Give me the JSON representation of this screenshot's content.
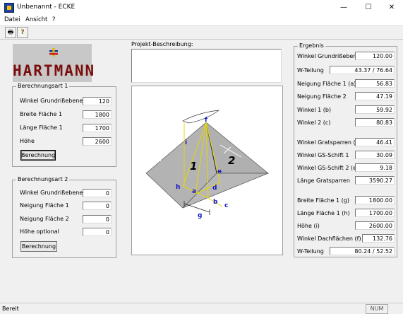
{
  "window": {
    "title": "Unbenannt - ECKE",
    "minimize": "—",
    "maximize": "☐",
    "close": "✕"
  },
  "menu": {
    "items": [
      "Datei",
      "Ansicht",
      "?"
    ]
  },
  "toolbar": {
    "print_icon": "🖶",
    "help_icon": "?"
  },
  "logo": {
    "text": "HARTMANN"
  },
  "calc1": {
    "title": "Berechnungsart 1",
    "rows": [
      {
        "label": "Winkel Grundrißebene",
        "value": "120"
      },
      {
        "label": "Breite Fläche 1",
        "value": "1800"
      },
      {
        "label": "Länge Fläche 1",
        "value": "1700"
      },
      {
        "label": "Höhe",
        "value": "2600"
      }
    ],
    "button": "Berechnung"
  },
  "calc2": {
    "title": "Berechnungsart 2",
    "rows": [
      {
        "label": "Winkel Grundrißebene",
        "value": "0"
      },
      {
        "label": "Neigung Fläche 1",
        "value": "0"
      },
      {
        "label": "Neigung Fläche 2",
        "value": "0"
      },
      {
        "label": "Höhe optional",
        "value": "0"
      }
    ],
    "button": "Berechnung"
  },
  "project": {
    "label": "Projekt-Beschreibung:",
    "value": ""
  },
  "diagram": {
    "labels": [
      "f",
      "i",
      "1",
      "2",
      "e",
      "h",
      "d",
      "a",
      "b",
      "c",
      "g"
    ]
  },
  "result": {
    "title": "Ergebnis",
    "rows": [
      {
        "label": "Winkel Grundrißebene",
        "value": "120.00"
      },
      {
        "label": "W-Teilung",
        "value": "43.37 / 76.64"
      },
      {
        "label": "Neigung Fläche 1 (a)",
        "value": "56.83"
      },
      {
        "label": "Neigung Fläche 2",
        "value": "47.19"
      },
      {
        "label": "Winkel 1 (b)",
        "value": "59.92"
      },
      {
        "label": "Winkel 2 (c)",
        "value": "80.83"
      },
      {
        "label": "Winkel Gratsparren (d)",
        "value": "46.41"
      },
      {
        "label": "Winkel GS-Schift 1",
        "value": "30.09"
      },
      {
        "label": "Winkel GS-Schift 2 (e)",
        "value": "9.18"
      },
      {
        "label": "Länge Gratsparren",
        "value": "3590.27"
      },
      {
        "label": "Breite Fläche 1 (g)",
        "value": "1800.00"
      },
      {
        "label": "Länge Fläche 1 (h)",
        "value": "1700.00"
      },
      {
        "label": "Höhe (i)",
        "value": "2600.00"
      },
      {
        "label": "Winkel Dachflächen (f)",
        "value": "132.76"
      },
      {
        "label": "W-Teilung",
        "value": "80.24 / 52.52"
      }
    ]
  },
  "status": {
    "text": "Bereit",
    "num": "NUM"
  },
  "colors": {
    "brand_red": "#7a0c0c",
    "roof_gray": "#b3b3b3",
    "construction_yellow": "#e6d800",
    "label_blue": "#1414c8"
  }
}
